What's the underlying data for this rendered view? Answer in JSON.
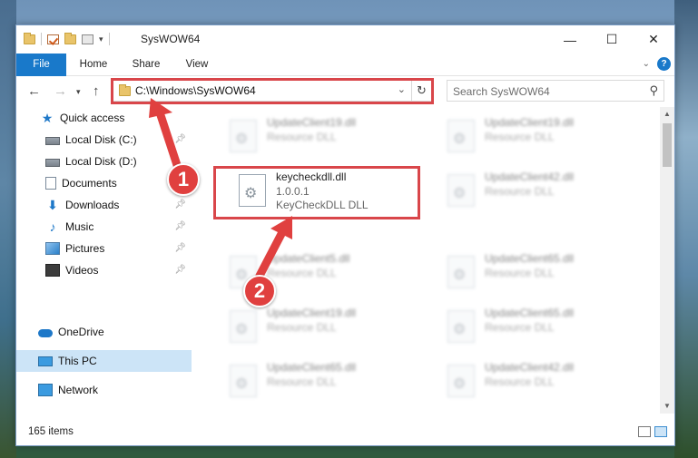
{
  "window": {
    "title": "SysWOW64"
  },
  "ribbon": {
    "tabs": [
      "File",
      "Home",
      "Share",
      "View"
    ]
  },
  "address": {
    "path": "C:\\Windows\\SysWOW64"
  },
  "search": {
    "placeholder": "Search SysWOW64"
  },
  "sidebar": {
    "items": [
      {
        "label": "Quick access"
      },
      {
        "label": "Local Disk (C:)"
      },
      {
        "label": "Local Disk (D:)"
      },
      {
        "label": "Documents"
      },
      {
        "label": "Downloads"
      },
      {
        "label": "Music"
      },
      {
        "label": "Pictures"
      },
      {
        "label": "Videos"
      },
      {
        "label": "OneDrive"
      },
      {
        "label": "This PC"
      },
      {
        "label": "Network"
      }
    ]
  },
  "files": {
    "left": [
      {
        "name": "UpdateClient19.dll",
        "type": "Resource DLL"
      },
      {
        "name": "keycheckdll.dll",
        "version": "1.0.0.1",
        "desc": "KeyCheckDLL DLL"
      },
      {
        "name": "UpdateClient5.dll",
        "type": "Resource DLL"
      },
      {
        "name": "UpdateClient19.dll",
        "type": "Resource DLL"
      },
      {
        "name": "UpdateClient65.dll",
        "type": "Resource DLL"
      }
    ],
    "right": [
      {
        "name": "UpdateClient19.dll",
        "type": "Resource DLL"
      },
      {
        "name": "UpdateClient42.dll",
        "type": "Resource DLL"
      },
      {
        "name": "UpdateClient65.dll",
        "type": "Resource DLL"
      },
      {
        "name": "UpdateClient65.dll",
        "type": "Resource DLL"
      },
      {
        "name": "UpdateClient42.dll",
        "type": "Resource DLL"
      }
    ]
  },
  "status": {
    "count": "165 items"
  },
  "annotations": {
    "step1": "1",
    "step2": "2"
  },
  "colors": {
    "accent": "#1979ca",
    "highlight": "#d9464a",
    "selected": "#cce4f7"
  }
}
